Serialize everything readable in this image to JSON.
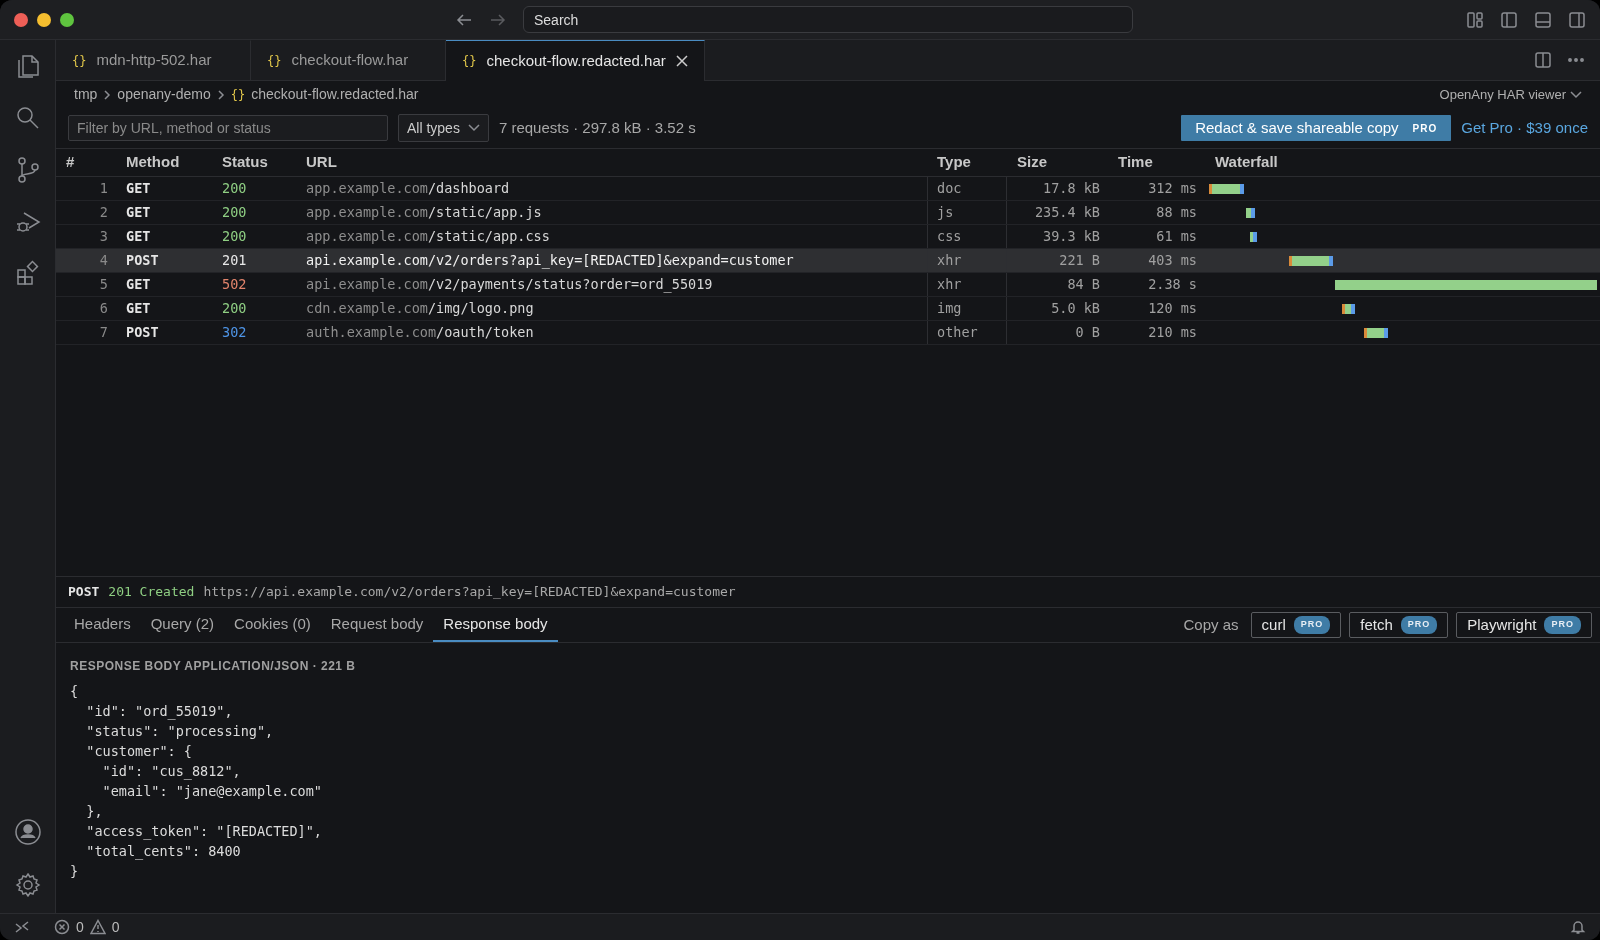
{
  "titlebar": {
    "search": "Search"
  },
  "editor_tabs": [
    {
      "icon": "{}",
      "label": "mdn-http-502.har",
      "selected": false
    },
    {
      "icon": "{}",
      "label": "checkout-flow.har",
      "selected": false
    },
    {
      "icon": "{}",
      "label": "checkout-flow.redacted.har",
      "selected": true
    }
  ],
  "breadcrumb": {
    "items": [
      {
        "label": "tmp"
      },
      {
        "label": "openany-demo"
      },
      {
        "icon": "{}",
        "label": "checkout-flow.redacted.har"
      }
    ],
    "viewer": "OpenAny HAR viewer"
  },
  "toolbar": {
    "filter": {
      "placeholder": "Filter by URL, method or status"
    },
    "type_select": "All types",
    "summary": "7 requests · 297.8 kB · 3.52 s",
    "redact_button": {
      "label": "Redact & save shareable copy",
      "badge": "PRO"
    },
    "pro_link": "Get Pro · $39 once"
  },
  "table": {
    "columns": [
      "#",
      "Method",
      "Status",
      "URL",
      "Type",
      "Size",
      "Time",
      "Waterfall"
    ],
    "rows": [
      {
        "num": "1",
        "method": "GET",
        "status": "200",
        "color": "#8fcf83",
        "host": "app.example.com",
        "path": "/dashboard",
        "type": "doc",
        "size": "17.8 kB",
        "time": "312 ms",
        "selected": false
      },
      {
        "num": "2",
        "method": "GET",
        "status": "200",
        "color": "#8fcf83",
        "host": "app.example.com",
        "path": "/static/app.js",
        "type": "js",
        "size": "235.4 kB",
        "time": "88 ms",
        "selected": false
      },
      {
        "num": "3",
        "method": "GET",
        "status": "200",
        "color": "#8fcf83",
        "host": "app.example.com",
        "path": "/static/app.css",
        "type": "css",
        "size": "39.3 kB",
        "time": "61 ms",
        "selected": false
      },
      {
        "num": "4",
        "method": "POST",
        "status": "201",
        "color": "#e8e8e8",
        "host": "api.example.com",
        "path": "/v2/orders?api_key=[REDACTED]&expand=customer",
        "type": "xhr",
        "size": "221 B",
        "time": "403 ms",
        "selected": true
      },
      {
        "num": "5",
        "method": "GET",
        "status": "502",
        "color": "#e2846c",
        "host": "api.example.com",
        "path": "/v2/payments/status?order=ord_55019",
        "type": "xhr",
        "size": "84 B",
        "time": "2.38 s",
        "selected": false
      },
      {
        "num": "6",
        "method": "GET",
        "status": "200",
        "color": "#8fcf83",
        "host": "cdn.example.com",
        "path": "/img/logo.png",
        "type": "img",
        "size": "5.0 kB",
        "time": "120 ms",
        "selected": false
      },
      {
        "num": "7",
        "method": "POST",
        "status": "302",
        "color": "#4e94e6",
        "host": "auth.example.com",
        "path": "/oauth/token",
        "type": "other",
        "size": "0 B",
        "time": "210 ms",
        "selected": false
      }
    ]
  },
  "detail": {
    "method": "POST",
    "status": "201 Created",
    "url": "https://api.example.com/v2/orders?api_key=[REDACTED]&expand=customer"
  },
  "detail_tabs": [
    {
      "label": "Headers",
      "selected": false
    },
    {
      "label": "Query (2)",
      "selected": false
    },
    {
      "label": "Cookies (0)",
      "selected": false
    },
    {
      "label": "Request body",
      "selected": false
    },
    {
      "label": "Response body",
      "selected": true
    }
  ],
  "copy_as": {
    "label": "Copy as",
    "buttons": [
      {
        "label": "curl",
        "badge": "PRO"
      },
      {
        "label": "fetch",
        "badge": "PRO"
      },
      {
        "label": "Playwright",
        "badge": "PRO"
      }
    ]
  },
  "response": {
    "heading": "RESPONSE BODY APPLICATION/JSON · 221 B",
    "lines": [
      "{",
      "  \"id\": \"ord_55019\",",
      "  \"status\": \"processing\",",
      "  \"customer\": {",
      "    \"id\": \"cus_8812\",",
      "    \"email\": \"jane@example.com\"",
      "  },",
      "  \"access_token\": \"[REDACTED]\",",
      "  \"total_cents\": 8400",
      "}"
    ]
  },
  "status_bar": {
    "errors": "0",
    "warnings": "0"
  }
}
